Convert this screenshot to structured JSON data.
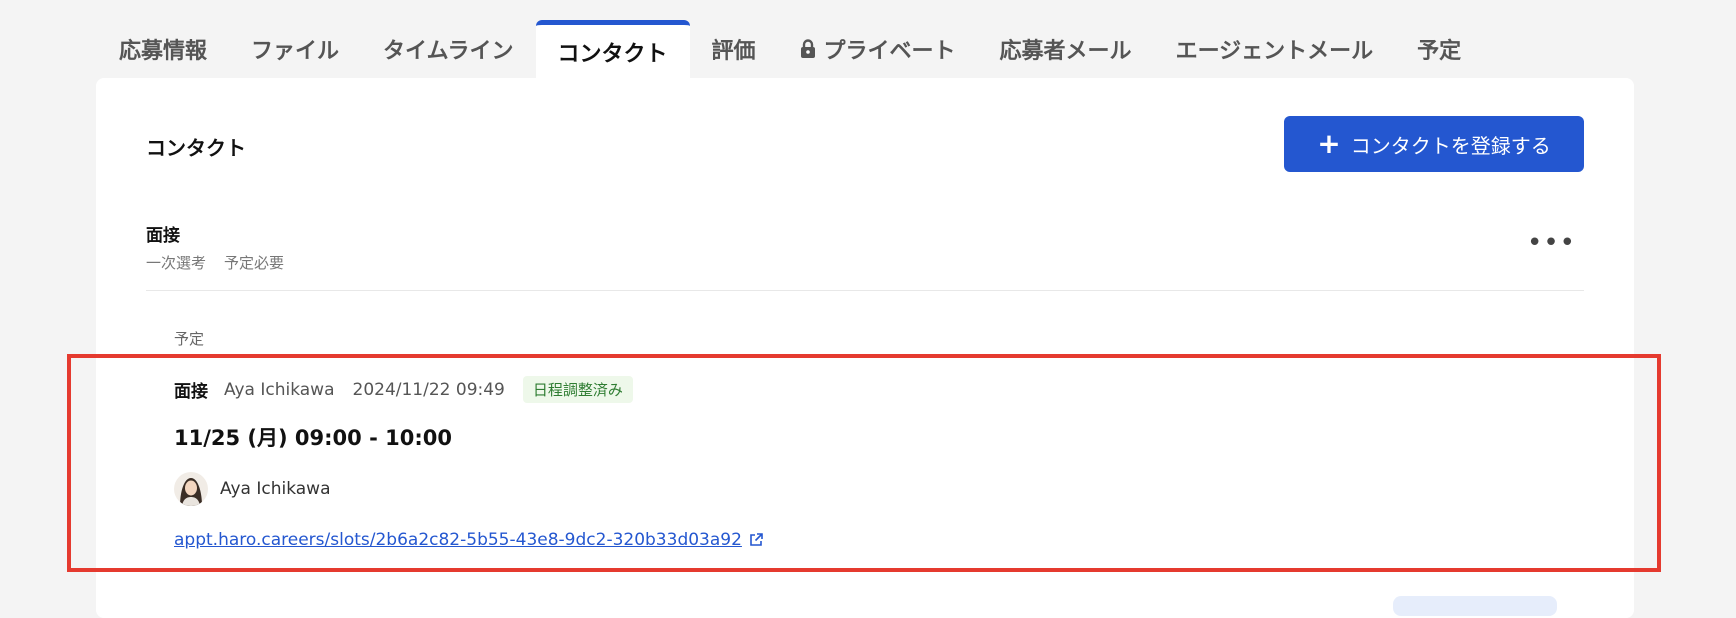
{
  "tabs": [
    {
      "label": "応募情報"
    },
    {
      "label": "ファイル"
    },
    {
      "label": "タイムライン"
    },
    {
      "label": "コンタクト",
      "active": true
    },
    {
      "label": "評価"
    },
    {
      "label": "プライベート",
      "icon": "lock-icon"
    },
    {
      "label": "応募者メール"
    },
    {
      "label": "エージェントメール"
    },
    {
      "label": "予定"
    }
  ],
  "panel": {
    "section_title": "コンタクト",
    "add_button": {
      "icon": "plus-icon",
      "label": "コンタクトを登録する"
    }
  },
  "item": {
    "title": "面接",
    "tags": [
      "一次選考",
      "予定必要"
    ],
    "more_icon": "more-horizontal-icon"
  },
  "schedule": {
    "label": "予定",
    "type": "面接",
    "owner": "Aya Ichikawa",
    "datetime": "2024/11/22 09:49",
    "status": "日程調整済み",
    "time_range": "11/25 (月) 09:00 - 10:00",
    "attendee": "Aya Ichikawa",
    "link": "appt.haro.careers/slots/2b6a2c82-5b55-43e8-9dc2-320b33d03a92",
    "link_icon": "external-link-icon"
  },
  "colors": {
    "accent": "#2457d0",
    "highlight": "#e53a2f",
    "status_text": "#2f7d32",
    "status_bg": "#eef8ea"
  }
}
